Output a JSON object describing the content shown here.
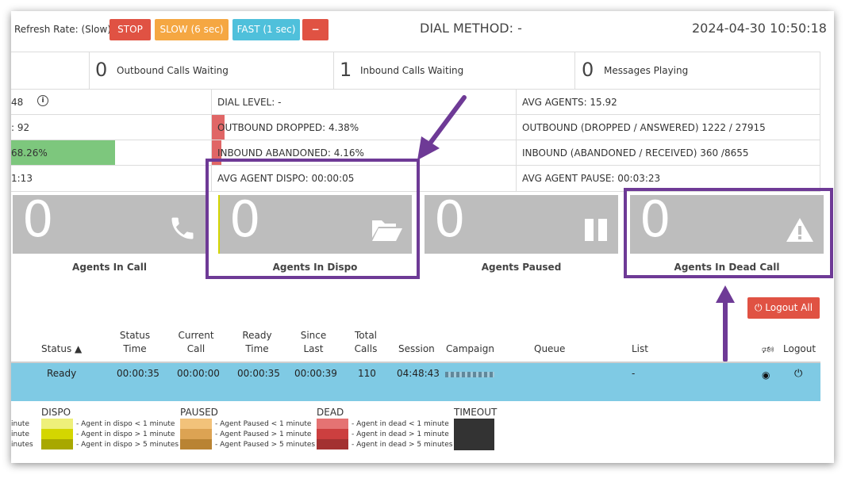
{
  "toolbar": {
    "refresh_rate": "Refresh Rate: (Slow)",
    "stop": "STOP",
    "slow": "SLOW (6 sec)",
    "fast": "FAST (1 sec)",
    "minus": "−",
    "dial_method": "DIAL METHOD: -",
    "datetime": "2024-04-30 10:50:18"
  },
  "counters": [
    {
      "value": "0",
      "label": "Outbound Calls Waiting"
    },
    {
      "value": "1",
      "label": "Inbound Calls Waiting"
    },
    {
      "value": "0",
      "label": "Messages Playing"
    }
  ],
  "stats": {
    "col1": [
      "48",
      ": 92",
      "68.26%",
      "1:13"
    ],
    "dial_level": "DIAL LEVEL: -",
    "outbound_dropped": "OUTBOUND DROPPED: 4.38%",
    "inbound_abandoned": "INBOUND ABANDONED: 4.16%",
    "avg_agent_dispo": "AVG AGENT DISPO: 00:00:05",
    "avg_agents": "AVG AGENTS: 15.92",
    "outbound_ratio": "OUTBOUND (DROPPED / ANSWERED) 1222 / 27915",
    "inbound_ratio": "INBOUND (ABANDONED / RECEIVED) 360 /8655",
    "avg_agent_pause": "AVG AGENT PAUSE: 00:03:23"
  },
  "tiles": [
    {
      "value": "0",
      "label": "Agents In Call",
      "icon": "phone-icon"
    },
    {
      "value": "0",
      "label": "Agents In Dispo",
      "icon": "folder-open-icon"
    },
    {
      "value": "0",
      "label": "Agents Paused",
      "icon": "pause-icon"
    },
    {
      "value": "0",
      "label": "Agents In Dead Call",
      "icon": "warning-icon"
    }
  ],
  "logout_all": "Logout All",
  "table": {
    "headers": {
      "status": "Status ▲",
      "status_time_1": "Status",
      "status_time_2": "Time",
      "current_call_1": "Current",
      "current_call_2": "Call",
      "ready_time_1": "Ready",
      "ready_time_2": "Time",
      "since_last_1": "Since",
      "since_last_2": "Last",
      "total_calls_1": "Total",
      "total_calls_2": "Calls",
      "session": "Session",
      "campaign": "Campaign",
      "queue": "Queue",
      "list": "List",
      "logout": "Logout"
    },
    "row": {
      "status": "Ready",
      "status_time": "00:00:35",
      "current_call": "00:00:00",
      "ready_time": "00:00:35",
      "since_last": "00:00:39",
      "total_calls": "110",
      "session": "04:48:43",
      "list": "-"
    }
  },
  "legend": {
    "left_fragments": [
      "inute",
      "inute",
      "inutes"
    ],
    "dispo": {
      "title": "DISPO",
      "items": [
        "- Agent in dispo < 1 minute",
        "- Agent in dispo > 1 minute",
        "- Agent in dispo > 5 minutes"
      ],
      "colors": [
        "#eef07a",
        "#d4d600",
        "#a8a800"
      ]
    },
    "paused": {
      "title": "PAUSED",
      "items": [
        "- Agent Paused < 1 minute",
        "- Agent Paused > 1 minute",
        "- Agent Paused > 5 minutes"
      ],
      "colors": [
        "#f2c27a",
        "#dca353",
        "#b98333"
      ]
    },
    "dead": {
      "title": "DEAD",
      "items": [
        "- Agent in dead < 1 minute",
        "- Agent in dead > 1 minute",
        "- Agent in dead > 5 minutes"
      ],
      "colors": [
        "#e57373",
        "#cc3f3f",
        "#a33131"
      ]
    },
    "timeout": {
      "title": "TIMEOUT",
      "color": "#333333"
    }
  },
  "colors": {
    "stop": "#e05243",
    "slow": "#f5a742",
    "fast": "#4fc0db",
    "minus": "#e05243",
    "tile": "#bdbdbd",
    "row_highlight": "#7fcae4",
    "annotation": "#6e3a96",
    "green_bar": "#7dc77d",
    "red_bar": "#e06666"
  }
}
